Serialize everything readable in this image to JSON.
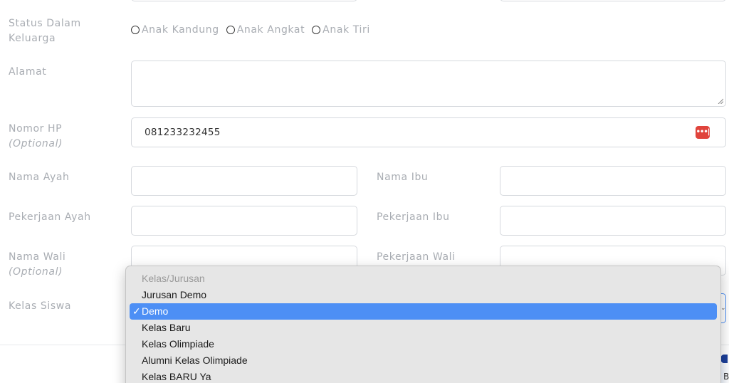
{
  "form": {
    "status_label": "Status Dalam Keluarga",
    "status_options": [
      "Anak Kandung",
      "Anak Angkat",
      "Anak Tiri"
    ],
    "alamat_label": "Alamat",
    "alamat_value": "",
    "nomor_hp_label": "Nomor HP",
    "nomor_hp_optional": "(Optional)",
    "nomor_hp_value": "081233232455",
    "nama_ayah_label": "Nama Ayah",
    "nama_ibu_label": "Nama Ibu",
    "pekerjaan_ayah_label": "Pekerjaan Ayah",
    "pekerjaan_ibu_label": "Pekerjaan Ibu",
    "nama_wali_label": "Nama Wali",
    "nama_wali_optional": "(Optional)",
    "pekerjaan_wali_label": "Pekerjaan Wali",
    "kelas_siswa_label": "Kelas Siswa"
  },
  "dropdown": {
    "header": "Kelas/Jurusan",
    "check_mark": "✓",
    "items": [
      "Jurusan Demo",
      "Demo",
      "Kelas Baru",
      "Kelas Olimpiade",
      "Alumni Kelas Olimpiade",
      "Kelas BARU Ya"
    ],
    "selected_item": "Demo"
  },
  "icons": {
    "password_manager": "password-manager-icon",
    "textarea_resize": "resize-grip-icon",
    "select_caret": "chevron-down-icon"
  },
  "colors": {
    "selection_blue": "#4d8ff5",
    "password_icon_red": "#e0443c"
  },
  "corner_text": "B"
}
